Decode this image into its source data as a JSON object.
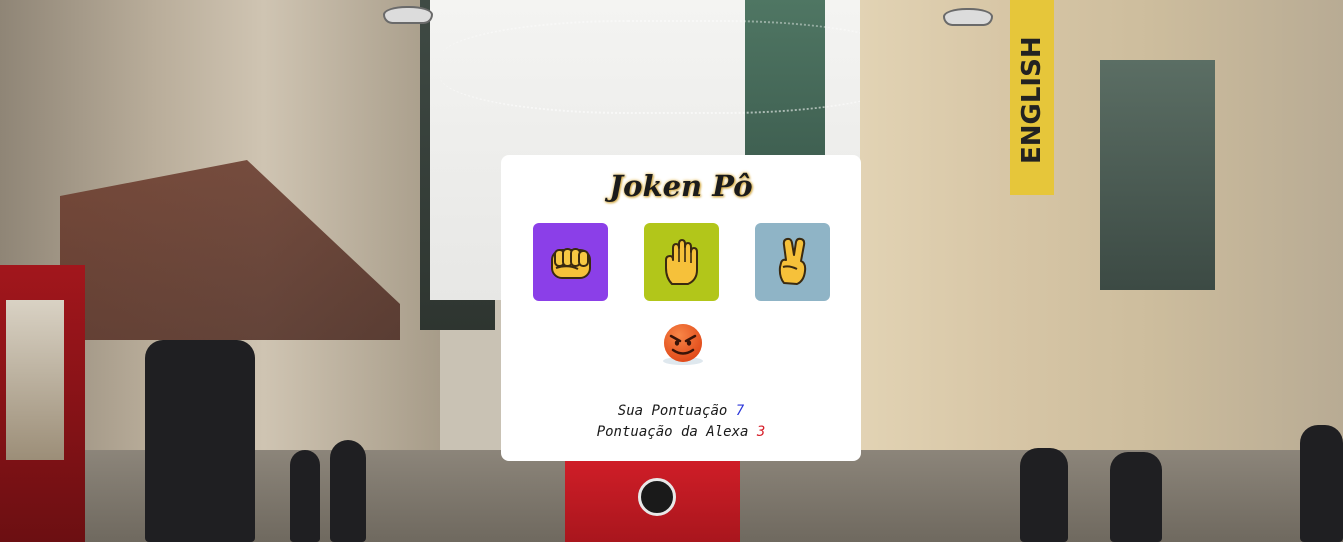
{
  "game": {
    "title": "Joken Pô",
    "choices": [
      {
        "name": "rock",
        "icon": "fist-icon",
        "color": "#8b3fe8"
      },
      {
        "name": "paper",
        "icon": "open-hand-icon",
        "color": "#b2c61a"
      },
      {
        "name": "scissors",
        "icon": "victory-hand-icon",
        "color": "#8fb4c6"
      }
    ],
    "opponent_icon": "angry-face-icon",
    "player_score_label": "Sua Pontuação",
    "player_score": "7",
    "alexa_score_label": "Pontuação da Alexa",
    "alexa_score": "3",
    "colors": {
      "player_score": "#2b36d9",
      "alexa_score": "#d61f2a"
    }
  },
  "background": {
    "sign_text": "ENGLISH"
  }
}
